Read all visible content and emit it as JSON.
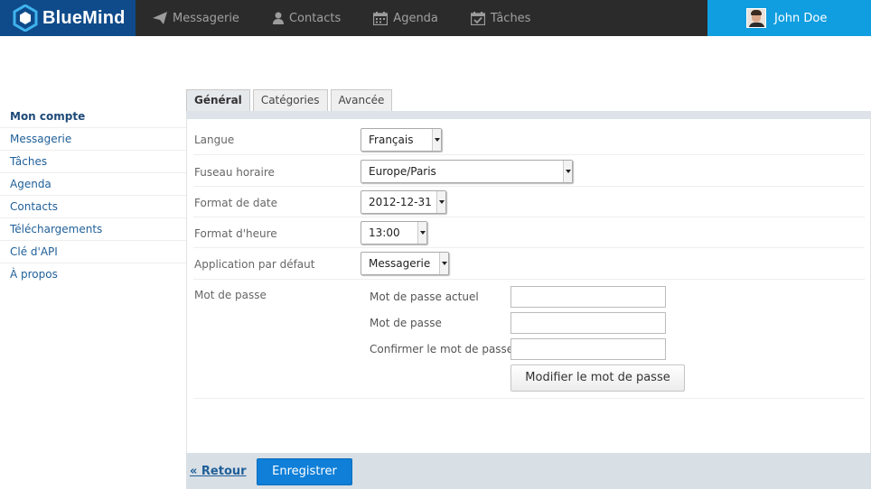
{
  "app": {
    "name": "BlueMind"
  },
  "nav": {
    "items": [
      {
        "label": "Messagerie",
        "icon": "paper-plane-icon"
      },
      {
        "label": "Contacts",
        "icon": "person-icon"
      },
      {
        "label": "Agenda",
        "icon": "calendar-icon"
      },
      {
        "label": "Tâches",
        "icon": "checklist-icon"
      }
    ]
  },
  "user": {
    "name": "John Doe"
  },
  "sidebar": {
    "items": [
      {
        "label": "Mon compte",
        "active": true
      },
      {
        "label": "Messagerie"
      },
      {
        "label": "Tâches"
      },
      {
        "label": "Agenda"
      },
      {
        "label": "Contacts"
      },
      {
        "label": "Téléchargements"
      },
      {
        "label": "Clé d'API"
      },
      {
        "label": "À propos"
      }
    ]
  },
  "tabs": [
    {
      "label": "Général",
      "active": true
    },
    {
      "label": "Catégories"
    },
    {
      "label": "Avancée"
    }
  ],
  "settings": {
    "language": {
      "label": "Langue",
      "value": "Français"
    },
    "timezone": {
      "label": "Fuseau horaire",
      "value": "Europe/Paris"
    },
    "date_format": {
      "label": "Format de date",
      "value": "2012-12-31"
    },
    "time_format": {
      "label": "Format d'heure",
      "value": "13:00"
    },
    "default_app": {
      "label": "Application par défaut",
      "value": "Messagerie"
    }
  },
  "password": {
    "label": "Mot de passe",
    "current_label": "Mot de passe actuel",
    "new_label": "Mot de passe",
    "confirm_label": "Confirmer le mot de passe",
    "button_label": "Modifier le mot de passe"
  },
  "footer": {
    "back_label": "« Retour",
    "save_label": "Enregistrer"
  },
  "colors": {
    "brand": "#0f4b8a",
    "accent": "#109ee0",
    "topbar": "#2b2b2b",
    "primary_button": "#0f7fd8"
  }
}
